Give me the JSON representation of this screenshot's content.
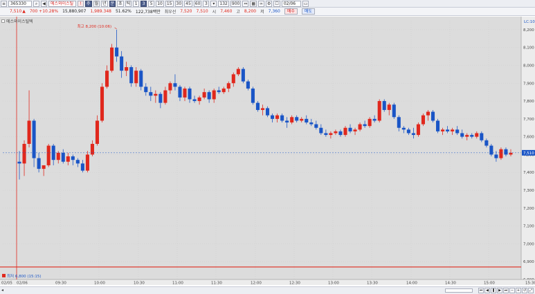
{
  "toolbar": {
    "code": "365330",
    "stock_name": "에스와이스틸텍",
    "buttons": [
      "주",
      "월",
      "년",
      "분",
      "초",
      "틱",
      "1",
      "3",
      "5",
      "10",
      "15",
      "30",
      "45",
      "60",
      "3"
    ],
    "period_value": "132",
    "count_value": "900",
    "date": "02/06"
  },
  "quote": {
    "price": "7,510",
    "change": "700 +10.28%",
    "volume": "15,880,907",
    "trade_value": "1,989.348",
    "ratio": "51.62%",
    "amount": "122,738백만",
    "ma_label": "최우선",
    "best_ask": "7,520",
    "best_bid": "7,510",
    "open_label": "시",
    "open": "7,460",
    "high_label": "고",
    "high": "8,200",
    "low_label": "저",
    "low": "7,360",
    "buy_label": "매수",
    "sell_label": "매도"
  },
  "legend": {
    "title": "에스와이스틸텍"
  },
  "annotations": {
    "high_text": "최고 8,200 (10:06)",
    "low_text": "최저 6,800 (15:15)"
  },
  "price_axis": {
    "top_label": "LC:10",
    "labels": [
      "8,200",
      "8,100",
      "8,000",
      "7,900",
      "7,800",
      "7,700",
      "7,600",
      "7,500",
      "7,400",
      "7,300",
      "7,200",
      "7,100",
      "7,000",
      "6,900",
      "6,800"
    ],
    "current_price": "7,510"
  },
  "time_axis": {
    "labels": [
      "02/05",
      "02/06",
      "09:30",
      "10:00",
      "10:30",
      "11:00",
      "11:30",
      "12:00",
      "12:30",
      "13:00",
      "13:30",
      "14:00",
      "14:30",
      "15:00",
      "15:30"
    ]
  },
  "chart_data": {
    "type": "candlestick",
    "title": "",
    "ylim": [
      6800,
      8250
    ],
    "up_color": "#e0281d",
    "down_color": "#1a55c6",
    "upper_limit_line": 8200,
    "lower_line_price": 6870,
    "candles": [
      [
        7460,
        7520,
        7360,
        7450
      ],
      [
        7450,
        7580,
        7380,
        7560
      ],
      [
        7560,
        7860,
        7540,
        7690
      ],
      [
        7690,
        7700,
        7430,
        7480
      ],
      [
        7480,
        7510,
        7400,
        7420
      ],
      [
        7420,
        7430,
        7380,
        7440
      ],
      [
        7440,
        7560,
        7430,
        7550
      ],
      [
        7550,
        7560,
        7440,
        7470
      ],
      [
        7470,
        7520,
        7450,
        7510
      ],
      [
        7510,
        7530,
        7450,
        7460
      ],
      [
        7460,
        7510,
        7440,
        7490
      ],
      [
        7490,
        7500,
        7440,
        7470
      ],
      [
        7470,
        7480,
        7430,
        7450
      ],
      [
        7450,
        7470,
        7400,
        7410
      ],
      [
        7410,
        7520,
        7400,
        7500
      ],
      [
        7500,
        7580,
        7490,
        7560
      ],
      [
        7560,
        7720,
        7550,
        7690
      ],
      [
        7690,
        7900,
        7680,
        7880
      ],
      [
        7880,
        8000,
        7870,
        7970
      ],
      [
        7970,
        8120,
        7960,
        8100
      ],
      [
        8100,
        8200,
        8020,
        8050
      ],
      [
        8050,
        8080,
        7930,
        7970
      ],
      [
        7970,
        8020,
        7940,
        7990
      ],
      [
        7990,
        8000,
        7880,
        7900
      ],
      [
        7900,
        7990,
        7880,
        7970
      ],
      [
        7970,
        7980,
        7860,
        7880
      ],
      [
        7880,
        7900,
        7830,
        7850
      ],
      [
        7850,
        7880,
        7800,
        7830
      ],
      [
        7830,
        7860,
        7790,
        7840
      ],
      [
        7840,
        7850,
        7760,
        7790
      ],
      [
        7790,
        7880,
        7780,
        7860
      ],
      [
        7860,
        7910,
        7840,
        7900
      ],
      [
        7900,
        7950,
        7860,
        7880
      ],
      [
        7880,
        7890,
        7800,
        7820
      ],
      [
        7820,
        7880,
        7800,
        7870
      ],
      [
        7870,
        7880,
        7790,
        7810
      ],
      [
        7810,
        7830,
        7790,
        7800
      ],
      [
        7800,
        7830,
        7780,
        7820
      ],
      [
        7820,
        7870,
        7810,
        7850
      ],
      [
        7850,
        7860,
        7790,
        7810
      ],
      [
        7810,
        7870,
        7790,
        7860
      ],
      [
        7860,
        7880,
        7840,
        7850
      ],
      [
        7850,
        7880,
        7840,
        7870
      ],
      [
        7870,
        7910,
        7850,
        7900
      ],
      [
        7900,
        7960,
        7880,
        7950
      ],
      [
        7950,
        7990,
        7940,
        7980
      ],
      [
        7980,
        7990,
        7900,
        7910
      ],
      [
        7910,
        7920,
        7860,
        7870
      ],
      [
        7870,
        7880,
        7780,
        7790
      ],
      [
        7790,
        7800,
        7740,
        7750
      ],
      [
        7750,
        7780,
        7720,
        7760
      ],
      [
        7760,
        7770,
        7710,
        7720
      ],
      [
        7720,
        7730,
        7680,
        7700
      ],
      [
        7700,
        7730,
        7680,
        7720
      ],
      [
        7720,
        7730,
        7680,
        7690
      ],
      [
        7690,
        7710,
        7650,
        7680
      ],
      [
        7680,
        7720,
        7670,
        7710
      ],
      [
        7710,
        7720,
        7680,
        7690
      ],
      [
        7690,
        7710,
        7680,
        7700
      ],
      [
        7700,
        7720,
        7670,
        7680
      ],
      [
        7680,
        7700,
        7660,
        7670
      ],
      [
        7670,
        7690,
        7640,
        7650
      ],
      [
        7650,
        7670,
        7610,
        7620
      ],
      [
        7620,
        7640,
        7600,
        7610
      ],
      [
        7610,
        7630,
        7590,
        7620
      ],
      [
        7620,
        7640,
        7610,
        7630
      ],
      [
        7630,
        7640,
        7600,
        7610
      ],
      [
        7610,
        7660,
        7600,
        7650
      ],
      [
        7650,
        7670,
        7620,
        7630
      ],
      [
        7630,
        7650,
        7610,
        7640
      ],
      [
        7640,
        7680,
        7630,
        7670
      ],
      [
        7670,
        7690,
        7650,
        7660
      ],
      [
        7660,
        7710,
        7650,
        7700
      ],
      [
        7700,
        7720,
        7680,
        7690
      ],
      [
        7690,
        7810,
        7680,
        7800
      ],
      [
        7800,
        7810,
        7740,
        7750
      ],
      [
        7750,
        7790,
        7720,
        7780
      ],
      [
        7780,
        7790,
        7700,
        7710
      ],
      [
        7710,
        7720,
        7630,
        7650
      ],
      [
        7650,
        7660,
        7620,
        7640
      ],
      [
        7640,
        7650,
        7610,
        7620
      ],
      [
        7620,
        7650,
        7590,
        7610
      ],
      [
        7610,
        7680,
        7600,
        7670
      ],
      [
        7670,
        7730,
        7660,
        7720
      ],
      [
        7720,
        7750,
        7690,
        7740
      ],
      [
        7740,
        7750,
        7680,
        7690
      ],
      [
        7690,
        7700,
        7620,
        7630
      ],
      [
        7630,
        7650,
        7610,
        7640
      ],
      [
        7640,
        7660,
        7620,
        7630
      ],
      [
        7630,
        7650,
        7610,
        7640
      ],
      [
        7640,
        7660,
        7610,
        7620
      ],
      [
        7620,
        7640,
        7590,
        7600
      ],
      [
        7600,
        7620,
        7580,
        7610
      ],
      [
        7610,
        7620,
        7590,
        7600
      ],
      [
        7600,
        7630,
        7590,
        7620
      ],
      [
        7620,
        7630,
        7570,
        7580
      ],
      [
        7580,
        7590,
        7540,
        7550
      ],
      [
        7550,
        7560,
        7490,
        7500
      ],
      [
        7500,
        7520,
        7460,
        7480
      ],
      [
        7480,
        7540,
        7470,
        7530
      ],
      [
        7530,
        7540,
        7490,
        7500
      ],
      [
        7500,
        7530,
        7490,
        7510
      ]
    ]
  }
}
